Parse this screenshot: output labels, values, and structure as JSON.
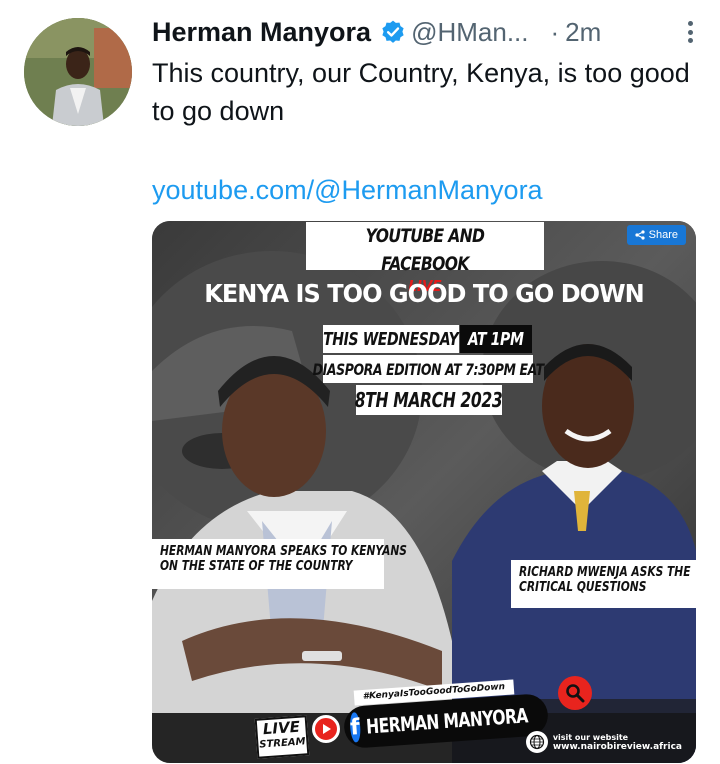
{
  "tweet": {
    "author_name": "Herman Manyora",
    "handle": "@HMan...",
    "separator": "·",
    "time": "2m",
    "text": "This country, our Country, Kenya, is too good to go down",
    "link": "youtube.com/@HermanManyora",
    "icons": {
      "verified": "verified-badge-icon",
      "more": "more-vertical-icon"
    },
    "colors": {
      "link": "#1d9bf0",
      "secondary_text": "#536471",
      "verified": "#1d9bf0"
    }
  },
  "poster": {
    "share_label": "Share",
    "banner_line1": "YOUTUBE AND FACEBOOK",
    "banner_live": "LIVE",
    "headline": "KENYA IS TOO GOOD TO GO DOWN",
    "day": "THIS WEDNESDAY",
    "time": "AT 1PM",
    "diaspora": "DIASPORA EDITION AT 7:30PM EAT",
    "date": "8TH MARCH 2023",
    "caption_left_line1": "HERMAN MANYORA SPEAKS TO KENYANS",
    "caption_left_line2": "ON THE STATE OF THE COUNTRY",
    "caption_right_line1": "RICHARD MWENJA ASKS THE",
    "caption_right_line2": "CRITICAL QUESTIONS",
    "hashtag": "#KenyaIsTooGoodToGoDown",
    "live_line1": "LIVE",
    "live_line2": "STREAM",
    "fb_letter": "f",
    "fb_name": "HERMAN MANYORA",
    "website_label": "visit our website",
    "website_url": "www.nairobireview.africa",
    "colors": {
      "share_button": "#1877d6",
      "live_red": "#e21b1b",
      "facebook_blue": "#1877f2",
      "youtube_red": "#e8241e"
    }
  }
}
